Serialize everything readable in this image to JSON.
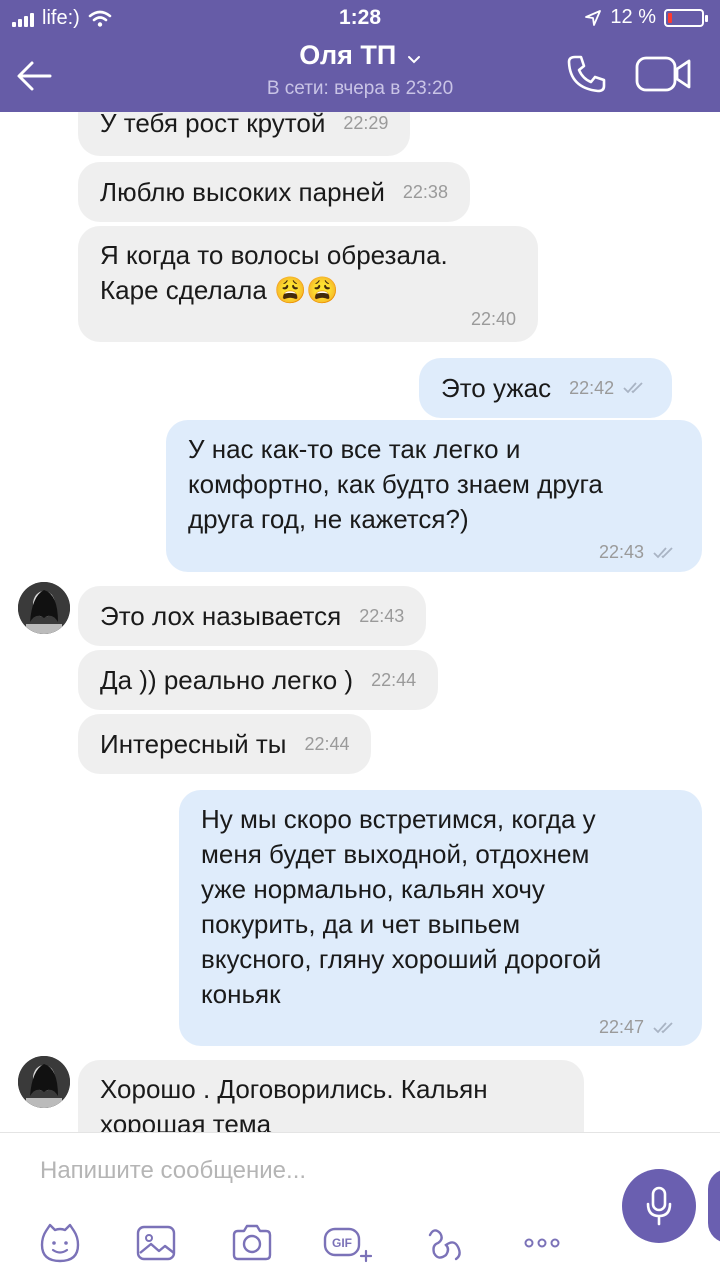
{
  "status_bar": {
    "carrier": "life:)",
    "time": "1:28",
    "battery_pct": "12 %",
    "battery_level": 0.12
  },
  "header": {
    "title": "Оля ТП",
    "subtitle": "В сети: вчера в 23:20",
    "colors": {
      "bar": "#665ca7",
      "subtitle": "#c9c4e6"
    }
  },
  "messages": [
    {
      "dir": "in",
      "text": "У тебя рост крутой",
      "time": "22:29"
    },
    {
      "dir": "in",
      "text": "Люблю высоких парней",
      "time": "22:38"
    },
    {
      "dir": "in",
      "text": "Я когда то волосы обрезала.\nКаре сделала",
      "emoji": "😩😩",
      "time": "22:40"
    },
    {
      "dir": "out",
      "text": "Это ужас",
      "time": "22:42"
    },
    {
      "dir": "out",
      "text": "У нас как-то все так легко и\nкомфортно, как будто знаем друга\nдруга год, не кажется?)",
      "time": "22:43"
    },
    {
      "dir": "in",
      "text": "Это лох называется",
      "time": "22:43"
    },
    {
      "dir": "in",
      "text": "Да )) реально легко )",
      "time": "22:44"
    },
    {
      "dir": "in",
      "text": "Интересный ты",
      "time": "22:44"
    },
    {
      "dir": "out",
      "text": "Ну мы скоро встретимся, когда у\nменя будет выходной, отдохнем\nуже нормально, кальян хочу\nпокурить, да и чет выпьем\nвкусного, гляну хороший дорогой\nконьяк",
      "time": "22:47"
    },
    {
      "dir": "in",
      "text": "Хорошо . Договорились.  Кальян\nхорошая тема"
    }
  ],
  "composer": {
    "placeholder": "Напишите сообщение...",
    "tools": [
      "sticker-icon",
      "gallery-icon",
      "camera-icon",
      "gif-icon",
      "doodle-icon",
      "more-icon"
    ],
    "accent": "#6a5fb0"
  },
  "colors": {
    "incoming_bubble": "#efefef",
    "outgoing_bubble": "#dfecfb",
    "time_text": "#9a9a9a"
  }
}
